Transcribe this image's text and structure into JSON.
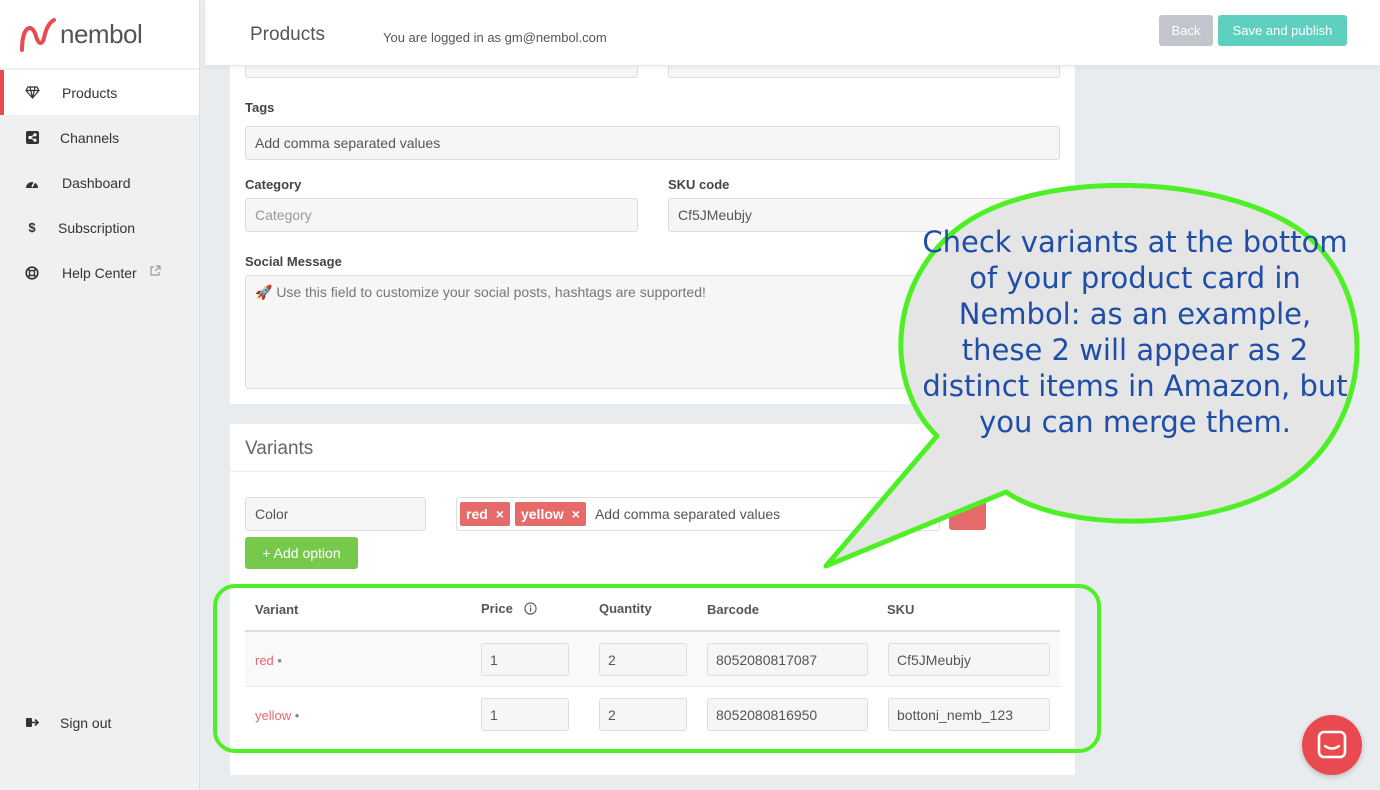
{
  "brand": {
    "name": "nembol",
    "accent": "#e84a4f"
  },
  "sidebar": {
    "items": [
      {
        "label": "Products",
        "icon": "diamond-icon",
        "active": true
      },
      {
        "label": "Channels",
        "icon": "share-icon"
      },
      {
        "label": "Dashboard",
        "icon": "dashboard-icon"
      },
      {
        "label": "Subscription",
        "icon": "dollar-icon"
      },
      {
        "label": "Help Center",
        "icon": "lifebuoy-icon"
      }
    ],
    "signout": "Sign out"
  },
  "header": {
    "title": "Products",
    "login_info": "You are logged in as gm@nembol.com",
    "back": "Back",
    "publish": "Save and publish"
  },
  "form": {
    "tags_label": "Tags",
    "tags_placeholder": "Add comma separated values",
    "category_label": "Category",
    "category_placeholder": "Category",
    "sku_label": "SKU code",
    "sku_value": "Cf5JMeubjy",
    "social_label": "Social Message",
    "social_placeholder": "🚀 Use this field to customize your social posts, hashtags are supported!"
  },
  "variants": {
    "title": "Variants",
    "option_name": "Color",
    "option_values": [
      "red",
      "yellow"
    ],
    "values_placeholder": "Add comma separated values",
    "add_option": "+ Add option",
    "headers": {
      "variant": "Variant",
      "price": "Price",
      "quantity": "Quantity",
      "barcode": "Barcode",
      "sku": "SKU"
    },
    "rows": [
      {
        "name": "red",
        "price": "1",
        "quantity": "2",
        "barcode": "8052080817087",
        "sku": "Cf5JMeubjy"
      },
      {
        "name": "yellow",
        "price": "1",
        "quantity": "2",
        "barcode": "8052080816950",
        "sku": "bottoni_nemb_123"
      }
    ]
  },
  "annotation": {
    "text": "Check variants at the bottom of your product card in Nembol: as an example, these 2 will appear as 2 distinct items in Amazon, but you can merge them."
  }
}
